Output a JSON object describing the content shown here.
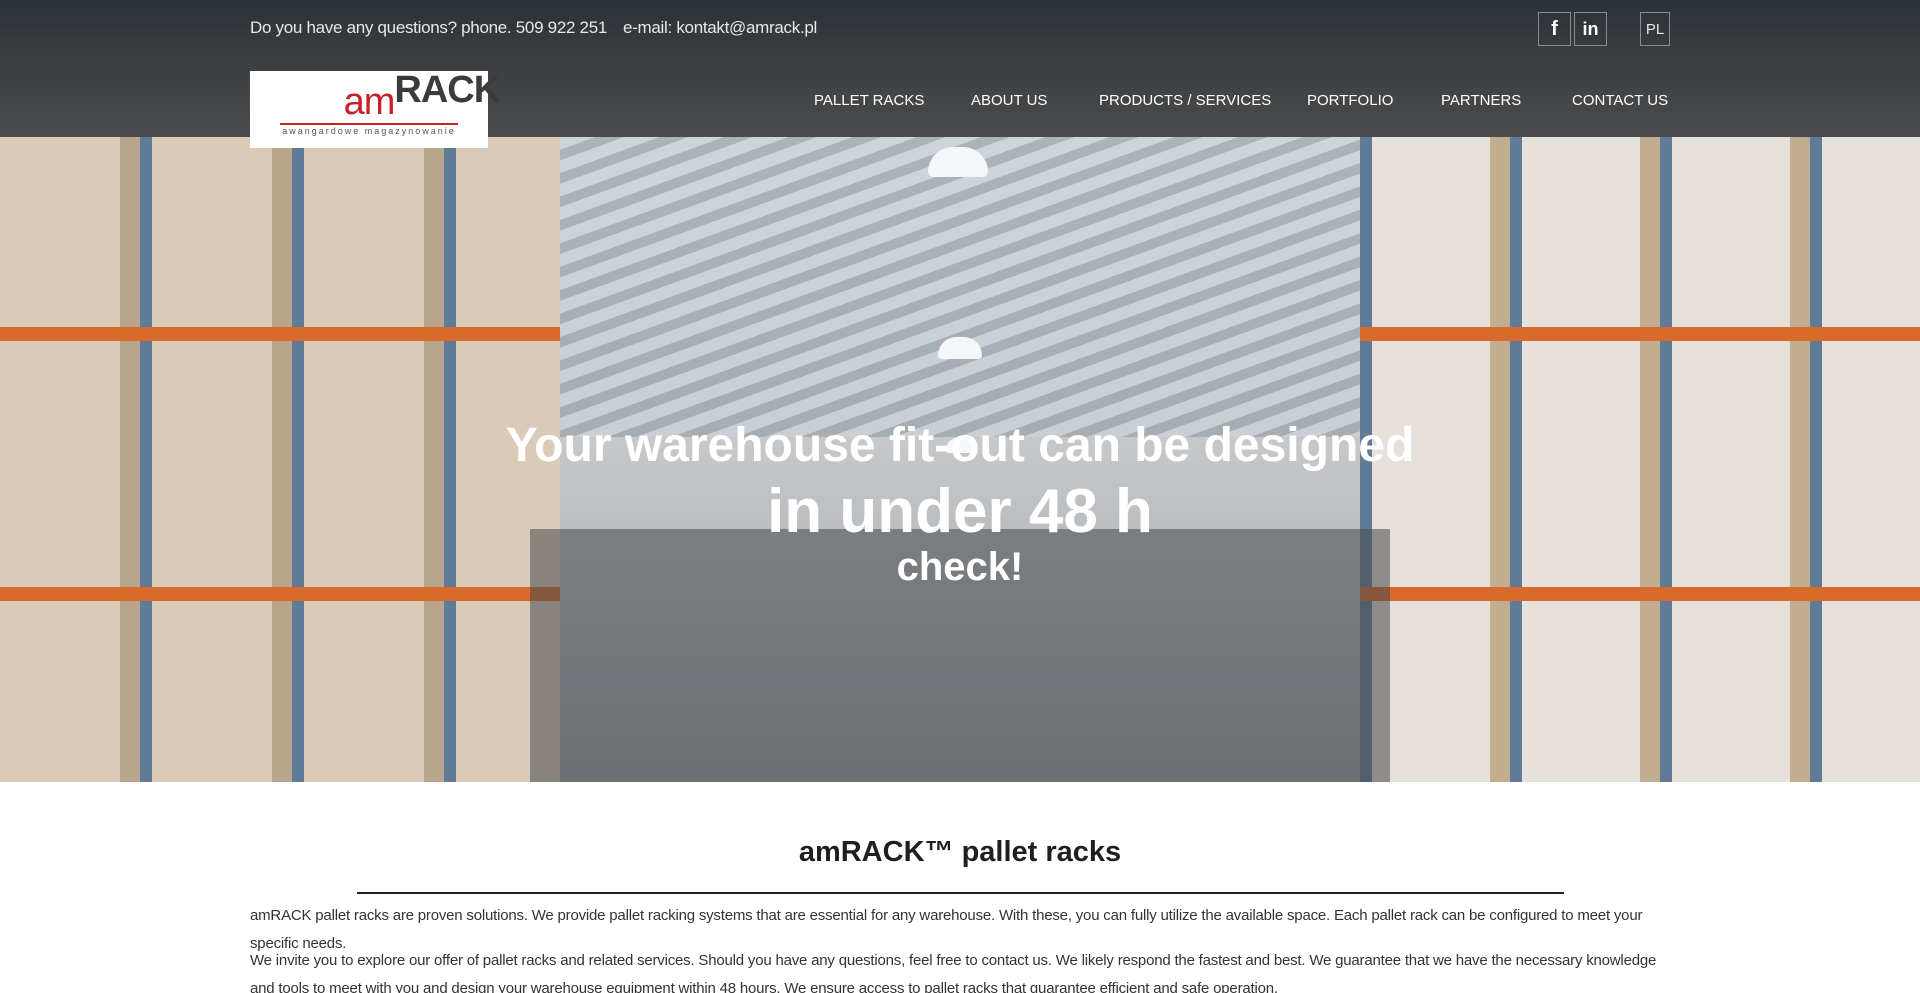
{
  "topbar": {
    "phone_text": "Do you have any questions? phone. 509 922 251",
    "email_text": "e-mail: kontakt@amrack.pl",
    "social": [
      {
        "name": "facebook-icon",
        "glyph": "f"
      },
      {
        "name": "linkedin-icon",
        "glyph": "in"
      }
    ],
    "language": "PL"
  },
  "logo": {
    "brand_am": "am",
    "brand_rack": "RACK",
    "tagline": "awangardowe magazynowanie"
  },
  "nav": {
    "items": [
      {
        "label": "PALLET RACKS"
      },
      {
        "label": "ABOUT US"
      },
      {
        "label": "PRODUCTS / SERVICES"
      },
      {
        "label": "PORTFOLIO"
      },
      {
        "label": "PARTNERS"
      },
      {
        "label": "CONTACT US"
      }
    ]
  },
  "hero": {
    "line1": "Your warehouse fit-out can be designed",
    "line2": "in under 48 h",
    "line3": "check!"
  },
  "content": {
    "title": "amRACK™ pallet racks",
    "paragraph1": "amRACK pallet racks are proven solutions. We provide pallet racking systems that are essential for any warehouse. With these, you can fully utilize the available space. Each pallet rack can be configured to meet your specific needs.",
    "paragraph2": "We invite you to explore our offer of pallet racks and related services. Should you have any questions, feel free to contact us. We likely respond the fastest and best. We guarantee that we have the necessary knowledge and tools to meet with you and design your warehouse equipment within 48 hours. We ensure access to pallet racks that guarantee efficient and safe operation."
  },
  "colors": {
    "brand_red": "#c8202a",
    "header_dark": "#2b3137",
    "rack_orange": "#d86a2c"
  }
}
